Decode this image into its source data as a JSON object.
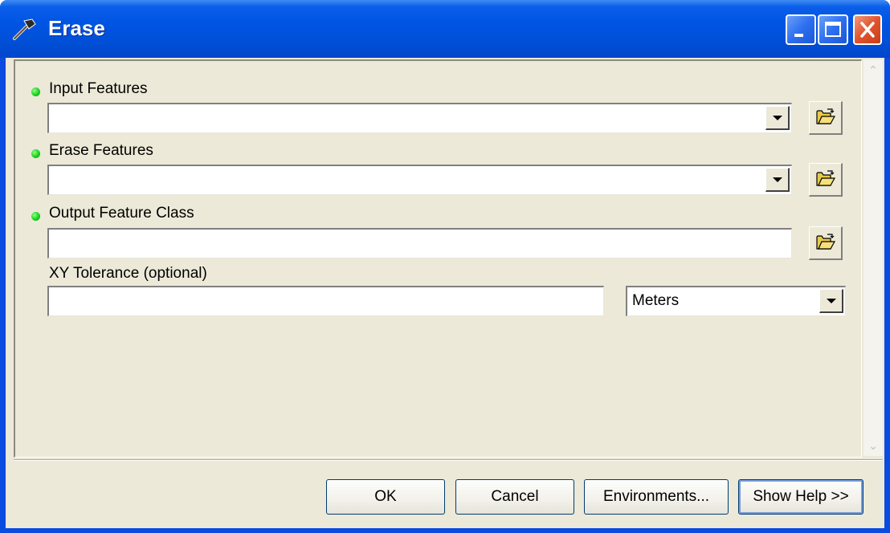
{
  "window": {
    "title": "Erase",
    "icon": "hammer-icon"
  },
  "titlebar_buttons": {
    "minimize": "minimize-icon",
    "maximize": "maximize-icon",
    "close": "close-icon"
  },
  "form": {
    "input_features": {
      "label": "Input Features",
      "value": "",
      "required": true
    },
    "erase_features": {
      "label": "Erase Features",
      "value": "",
      "required": true
    },
    "output_feature_class": {
      "label": "Output Feature Class",
      "value": "",
      "required": true
    },
    "xy_tolerance": {
      "label": "XY Tolerance (optional)",
      "value": "",
      "unit": "Meters"
    }
  },
  "buttons": {
    "ok": "OK",
    "cancel": "Cancel",
    "environments": "Environments...",
    "show_help": "Show Help >>"
  },
  "colors": {
    "titlebar": "#0054e3",
    "client": "#ece9d8",
    "required_dot": "#1bd11b",
    "close_button": "#e0532c"
  }
}
